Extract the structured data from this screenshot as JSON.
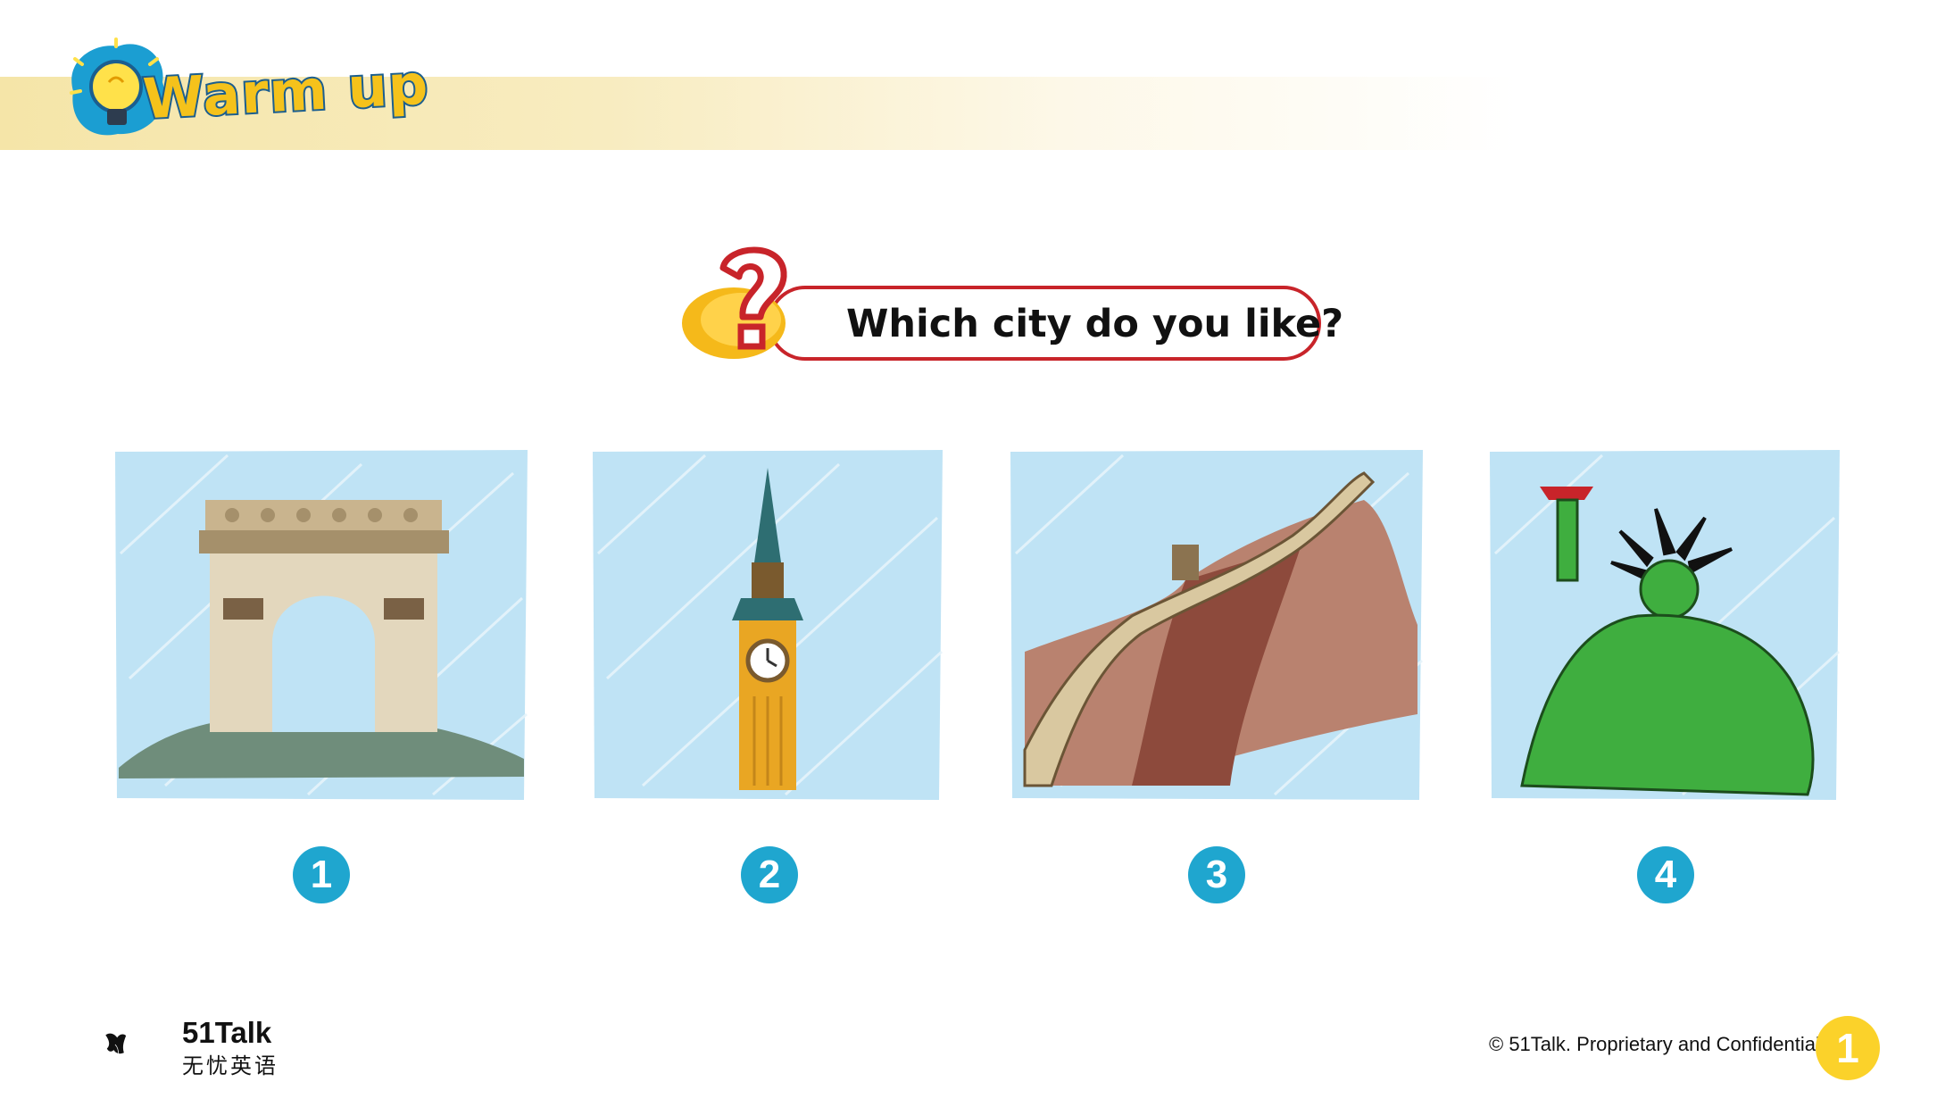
{
  "header": {
    "title": "Warm up",
    "band_color": "#f5e5a8",
    "title_color": "#f5c21b",
    "outline_color": "#1b5e8f"
  },
  "question": {
    "text": "Which city do you like?",
    "border_color": "#c8242a",
    "icon": "question-mark-icon"
  },
  "cards": [
    {
      "number": "1",
      "image": "arc-de-triomphe-illustration"
    },
    {
      "number": "2",
      "image": "big-ben-illustration"
    },
    {
      "number": "3",
      "image": "great-wall-illustration"
    },
    {
      "number": "4",
      "image": "statue-of-liberty-illustration"
    }
  ],
  "number_color": "#1fa6cf",
  "footer": {
    "brand": "51Talk",
    "brand_cn": "无忧英语",
    "copyright": "© 51Talk. Proprietary and Confidential.",
    "page_number": "1",
    "page_badge_color": "#fbd22a"
  }
}
